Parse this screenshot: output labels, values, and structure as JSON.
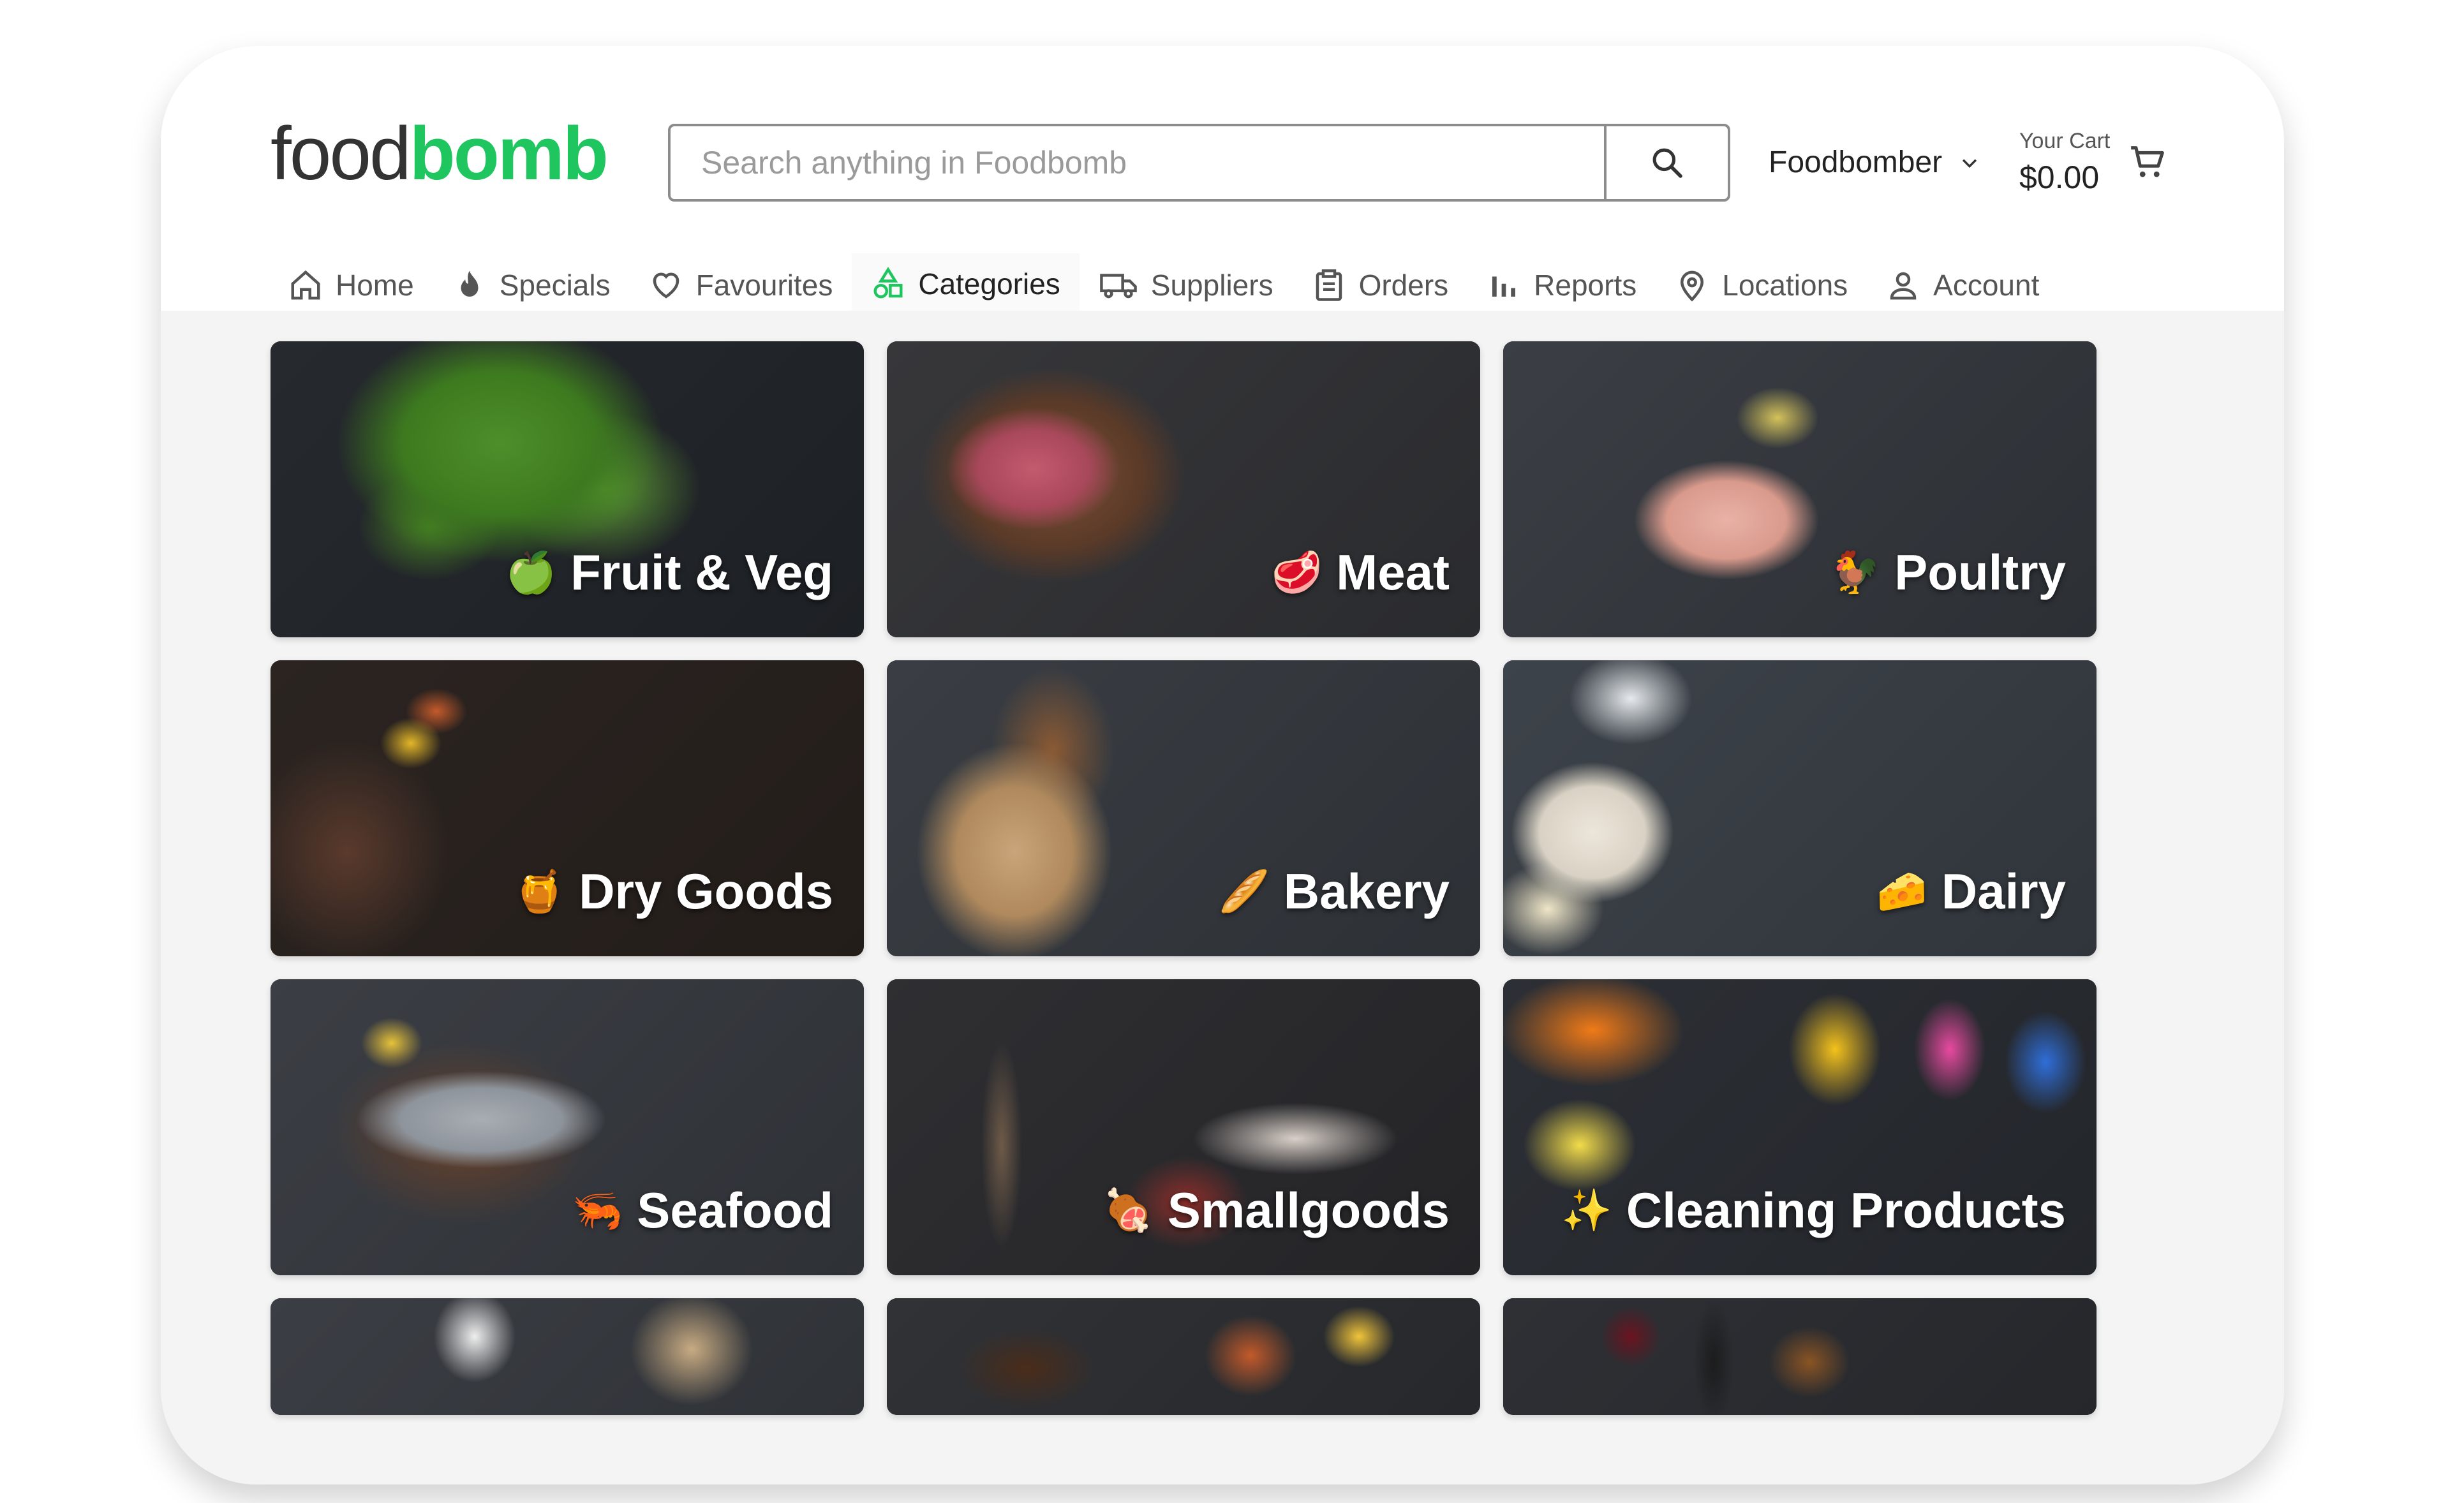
{
  "brand": {
    "logo_part1": "food",
    "logo_part2": "bomb",
    "accent": "#1fc55e"
  },
  "search": {
    "placeholder": "Search anything in Foodbomb",
    "value": ""
  },
  "user_menu": {
    "label": "Foodbomber"
  },
  "cart": {
    "label": "Your Cart",
    "total": "$0.00"
  },
  "nav": [
    {
      "label": "Home",
      "icon": "home-icon"
    },
    {
      "label": "Specials",
      "icon": "flame-icon"
    },
    {
      "label": "Favourites",
      "icon": "heart-icon"
    },
    {
      "label": "Categories",
      "icon": "categories-icon",
      "active": true
    },
    {
      "label": "Suppliers",
      "icon": "truck-icon"
    },
    {
      "label": "Orders",
      "icon": "clipboard-icon"
    },
    {
      "label": "Reports",
      "icon": "bar-chart-icon"
    },
    {
      "label": "Locations",
      "icon": "map-pin-icon"
    },
    {
      "label": "Account",
      "icon": "user-icon"
    }
  ],
  "categories": [
    {
      "label": "Fruit & Veg",
      "emoji": "🍏",
      "bg": "#3a6a22"
    },
    {
      "label": "Meat",
      "emoji": "🥩",
      "bg": "#3a3533"
    },
    {
      "label": "Poultry",
      "emoji": "🐓",
      "bg": "#34383e"
    },
    {
      "label": "Dry Goods",
      "emoji": "🍯",
      "bg": "#2e2622"
    },
    {
      "label": "Bakery",
      "emoji": "🥖",
      "bg": "#3a3e45"
    },
    {
      "label": "Dairy",
      "emoji": "🧀",
      "bg": "#3d434a"
    },
    {
      "label": "Seafood",
      "emoji": "🦐",
      "bg": "#3c3f45"
    },
    {
      "label": "Smallgoods",
      "emoji": "🍖",
      "bg": "#2e2e31"
    },
    {
      "label": "Cleaning Products",
      "emoji": "✨",
      "bg": "#2c2f35"
    },
    {
      "label": "",
      "emoji": "",
      "bg": "#3b3e44"
    },
    {
      "label": "",
      "emoji": "",
      "bg": "#303236"
    },
    {
      "label": "",
      "emoji": "",
      "bg": "#2e3035"
    }
  ]
}
